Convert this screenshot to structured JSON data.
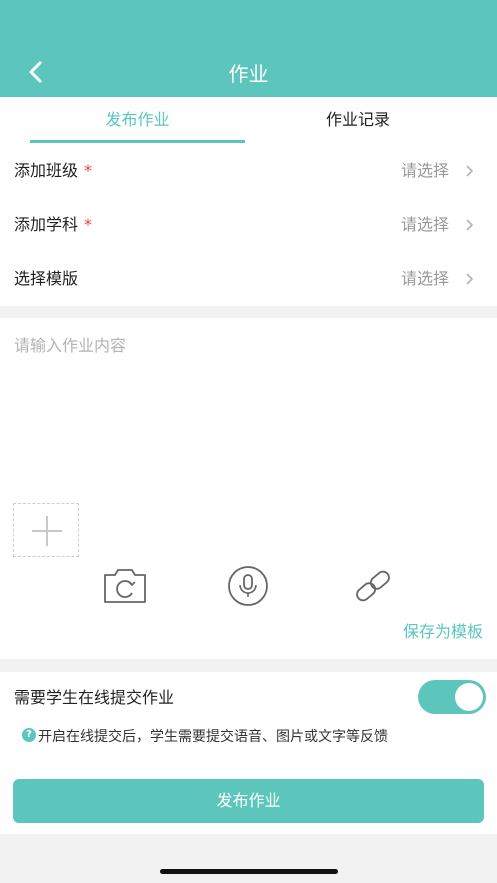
{
  "header": {
    "title": "作业",
    "back_icon": "chevron-left-icon"
  },
  "tabs": [
    {
      "label": "发布作业",
      "active": true
    },
    {
      "label": "作业记录",
      "active": false
    }
  ],
  "form": {
    "rows": [
      {
        "label": "添加班级",
        "required": true,
        "required_mark": "*",
        "value": "请选择"
      },
      {
        "label": "添加学科",
        "required": true,
        "required_mark": "*",
        "value": "请选择"
      },
      {
        "label": "选择模版",
        "required": false,
        "required_mark": "",
        "value": "请选择"
      }
    ]
  },
  "content": {
    "placeholder": "请输入作业内容",
    "value": "",
    "tools": [
      "camera-icon",
      "microphone-icon",
      "link-icon"
    ],
    "save_template_label": "保存为模板"
  },
  "online_submit": {
    "label": "需要学生在线提交作业",
    "enabled": true,
    "help_icon_text": "?",
    "help_text": "开启在线提交后，学生需要提交语音、图片或文字等反馈"
  },
  "publish_button_label": "发布作业",
  "colors": {
    "accent": "#5cc6bd",
    "required": "#e64340",
    "placeholder": "#999999"
  }
}
